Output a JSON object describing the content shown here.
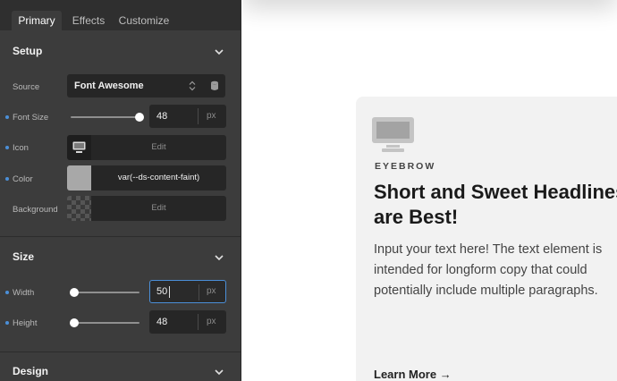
{
  "tabs": [
    {
      "label": "Primary",
      "active": true
    },
    {
      "label": "Effects",
      "active": false
    },
    {
      "label": "Customize",
      "active": false
    }
  ],
  "setup": {
    "title": "Setup",
    "source": {
      "label": "Source",
      "value": "Font Awesome"
    },
    "font_size": {
      "label": "Font Size",
      "value": "48",
      "unit": "px",
      "slider_level": 1.0
    },
    "icon": {
      "label": "Icon",
      "action": "Edit"
    },
    "color": {
      "label": "Color",
      "value": "var(--ds-content-faint)",
      "swatch": "#a8a8a8"
    },
    "background": {
      "label": "Background",
      "action": "Edit"
    }
  },
  "size": {
    "title": "Size",
    "width": {
      "label": "Width",
      "value": "50",
      "unit": "px",
      "slider_level": 0.0
    },
    "height": {
      "label": "Height",
      "value": "48",
      "unit": "px",
      "slider_level": 0.0
    }
  },
  "design": {
    "title": "Design"
  },
  "preview": {
    "eyebrow": "EYEBROW",
    "headline": "Short and Sweet Headlines are Best!",
    "body": "Input your text here! The text element is intended for longform copy that could potentially include multiple paragraphs.",
    "link": "Learn More"
  },
  "colors": {
    "accent": "#4b8fd8",
    "panel": "#3c3c3c",
    "card": "#f2f2f2"
  }
}
